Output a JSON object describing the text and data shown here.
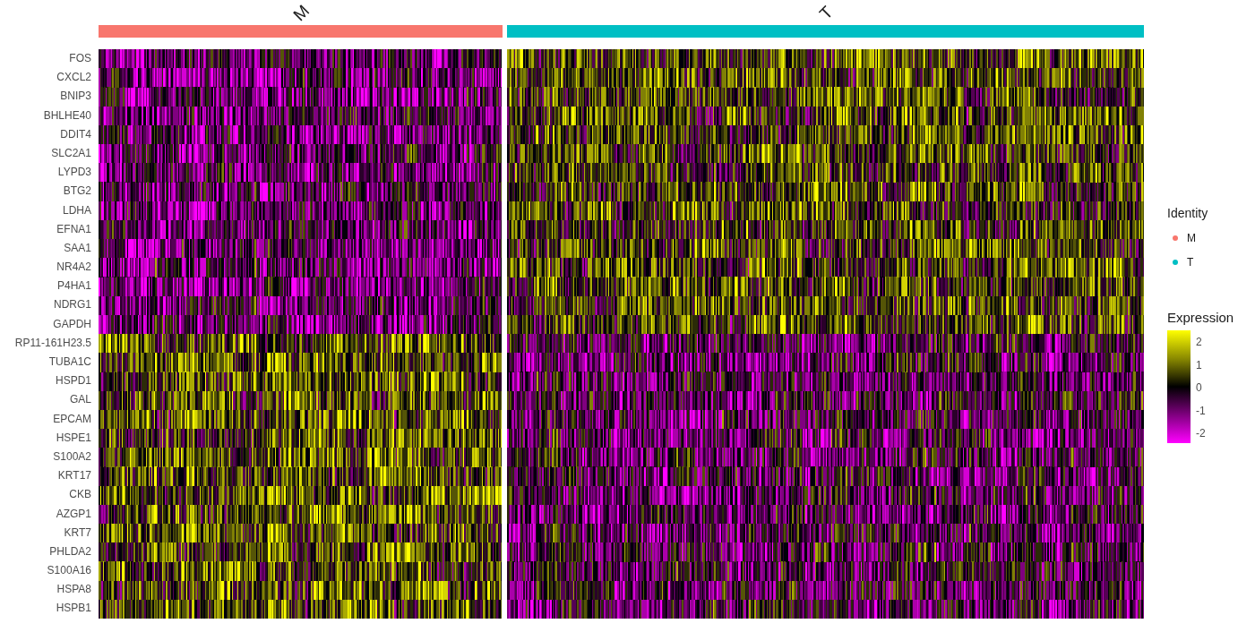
{
  "groups": [
    {
      "label": "M",
      "color": "#f8766d"
    },
    {
      "label": "T",
      "color": "#00bfc4"
    }
  ],
  "genes": [
    "FOS",
    "CXCL2",
    "BNIP3",
    "BHLHE40",
    "DDIT4",
    "SLC2A1",
    "LYPD3",
    "BTG2",
    "LDHA",
    "EFNA1",
    "SAA1",
    "NR4A2",
    "P4HA1",
    "NDRG1",
    "GAPDH",
    "RP11-161H23.5",
    "TUBA1C",
    "HSPD1",
    "GAL",
    "EPCAM",
    "HSPE1",
    "S100A2",
    "KRT17",
    "CKB",
    "AZGP1",
    "KRT7",
    "PHLDA2",
    "S100A16",
    "HSPA8",
    "HSPB1"
  ],
  "legend": {
    "identity": {
      "title": "Identity",
      "items": [
        {
          "label": "M",
          "color": "#f8766d"
        },
        {
          "label": "T",
          "color": "#00bfc4"
        }
      ]
    },
    "expression": {
      "title": "Expression",
      "ticks": [
        "2",
        "1",
        "0",
        "-1",
        "-2"
      ]
    }
  }
}
